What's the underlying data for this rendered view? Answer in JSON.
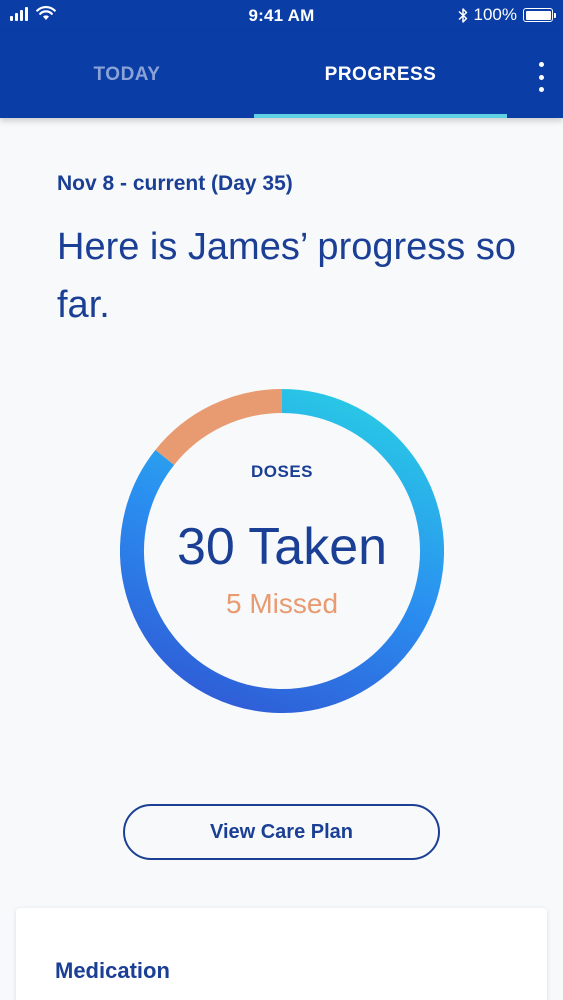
{
  "status_bar": {
    "time": "9:41 AM",
    "battery_text": "100%",
    "battery_level": 1.0,
    "icons": [
      "signal-icon",
      "wifi-icon",
      "bluetooth-icon",
      "battery-icon"
    ]
  },
  "tabs": [
    {
      "label": "TODAY",
      "active": false
    },
    {
      "label": "PROGRESS",
      "active": true
    }
  ],
  "menu_icon": "more-vertical-icon",
  "progress": {
    "date_range": "Nov 8 - current (Day 35)",
    "headline": "Here is James’ progress so far."
  },
  "doses": {
    "title": "DOSES",
    "taken_label": "30 Taken",
    "missed_label": "5 Missed",
    "taken": 30,
    "missed": 5
  },
  "colors": {
    "primary": "#0a3da6",
    "text_primary": "#1a3f94",
    "accent_tab": "#5fd1e4",
    "missed": "#e89a70",
    "taken_gradient_start": "#29c6e6",
    "taken_gradient_mid": "#2a8ff0",
    "taken_gradient_end": "#2f5fd8"
  },
  "care_plan_button": {
    "label": "View Care Plan"
  },
  "medication_card": {
    "title": "Medication"
  }
}
